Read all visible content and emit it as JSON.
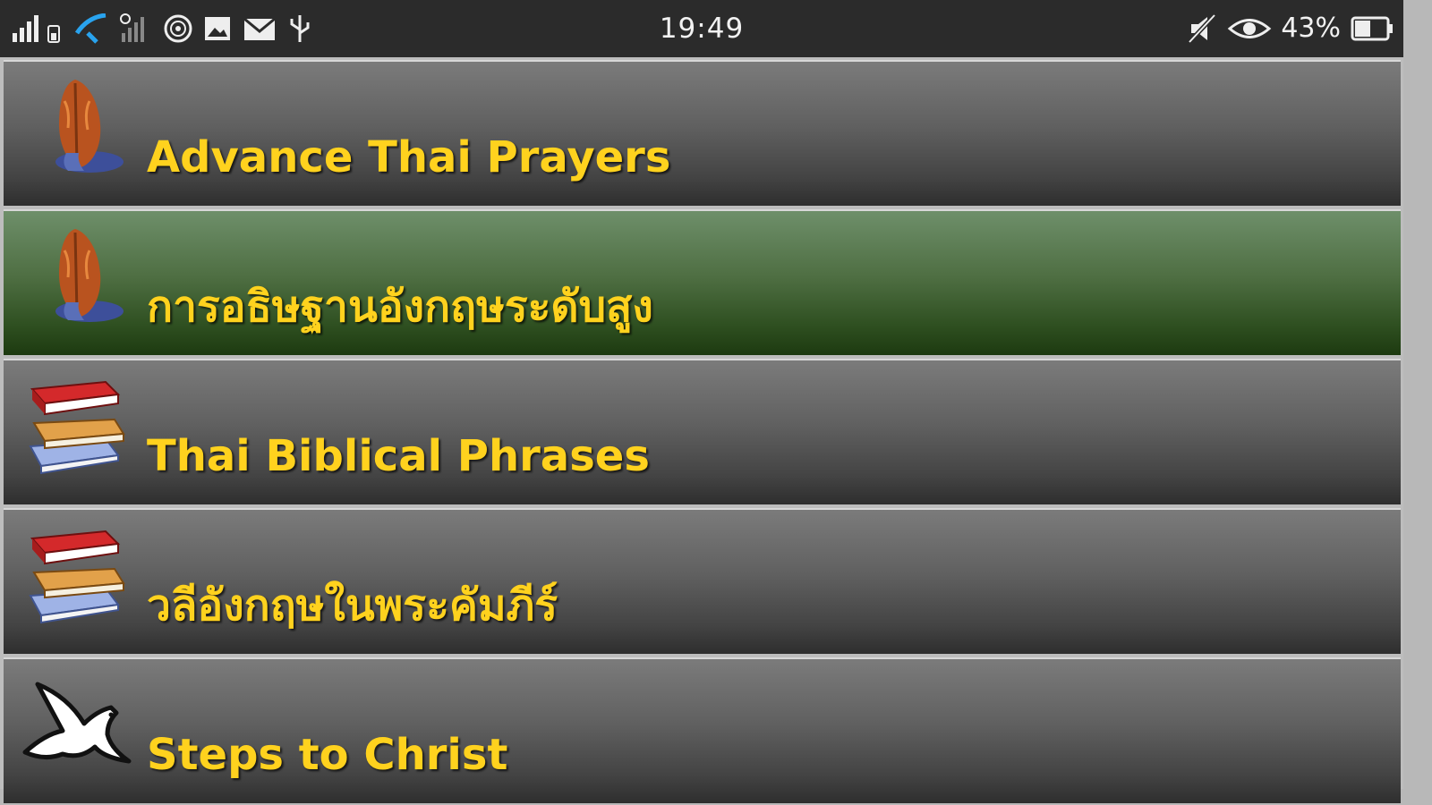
{
  "status_bar": {
    "time": "19:49",
    "battery_percent": "43%",
    "left_icons": [
      "signal-icon",
      "wifi-icon",
      "signal-no-sim-icon",
      "hotspot-icon",
      "image-icon",
      "mail-icon",
      "usb-icon"
    ],
    "right_icons": [
      "mute-icon",
      "eye-icon",
      "battery-icon"
    ]
  },
  "menu": {
    "items": [
      {
        "label": "Advance Thai Prayers",
        "icon": "praying-hands-icon",
        "selected": false
      },
      {
        "label": "การอธิษฐานอังกฤษระดับสูง",
        "icon": "praying-hands-icon",
        "selected": true
      },
      {
        "label": "Thai Biblical Phrases",
        "icon": "books-icon",
        "selected": false
      },
      {
        "label": "วลีอังกฤษในพระคัมภีร์",
        "icon": "books-icon",
        "selected": false
      },
      {
        "label": "Steps to Christ",
        "icon": "dove-icon",
        "selected": false
      }
    ]
  },
  "colors": {
    "label_text": "#ffd21e",
    "item_background": "#5a5a5a",
    "selected_background": "#3f5f33",
    "status_bar": "#2b2b2b"
  }
}
